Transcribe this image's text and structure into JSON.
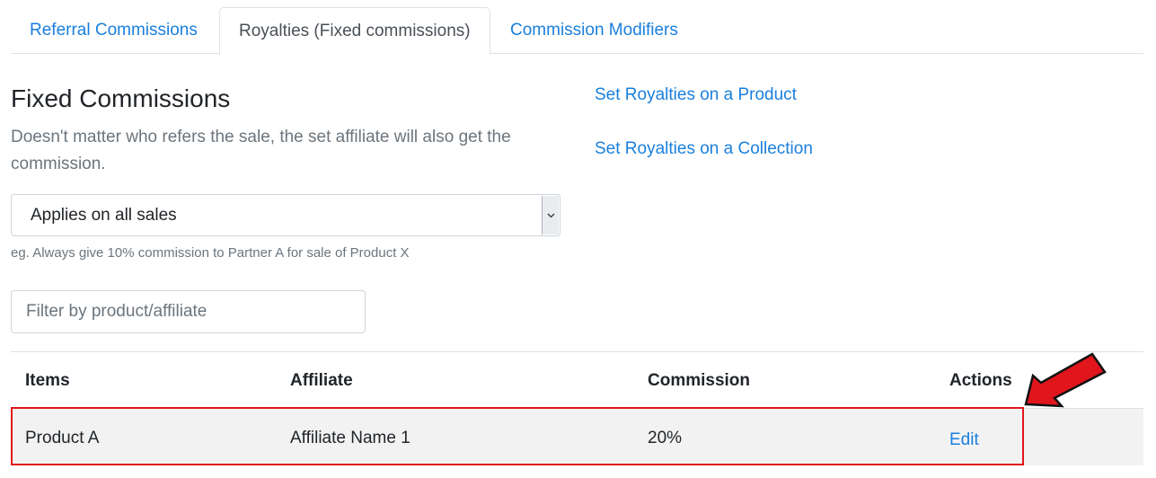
{
  "tabs": [
    {
      "label": "Referral Commissions",
      "active": false
    },
    {
      "label": "Royalties (Fixed commissions)",
      "active": true
    },
    {
      "label": "Commission Modifiers",
      "active": false
    }
  ],
  "section": {
    "title": "Fixed Commissions",
    "description": "Doesn't matter who refers the sale, the set affiliate will also get the commission."
  },
  "scope_select": {
    "selected": "Applies on all sales",
    "hint": "eg. Always give 10% commission to Partner A for sale of Product X"
  },
  "filter": {
    "placeholder": "Filter by product/affiliate",
    "value": ""
  },
  "links": {
    "product": "Set Royalties on a Product",
    "collection": "Set Royalties on a Collection"
  },
  "table": {
    "headers": [
      "Items",
      "Affiliate",
      "Commission",
      "Actions"
    ],
    "rows": [
      {
        "item": "Product A",
        "affiliate": "Affiliate Name 1",
        "commission": "20%",
        "action": "Edit"
      }
    ]
  },
  "colors": {
    "link": "#1a7fdc",
    "highlight": "#e0161c",
    "row_bg": "#f2f2f2"
  },
  "icons": {
    "select_arrow": "chevron-down-icon",
    "annotation": "red-arrow-icon"
  }
}
